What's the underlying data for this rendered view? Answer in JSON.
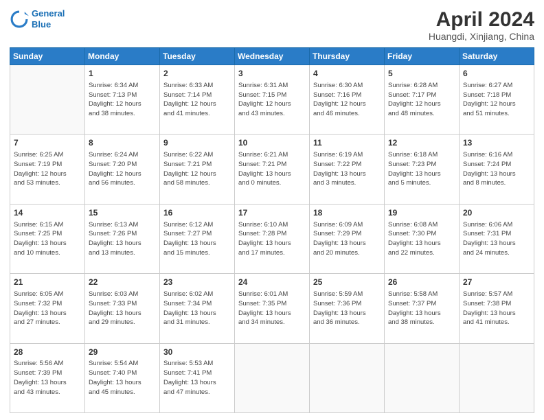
{
  "header": {
    "logo_line1": "General",
    "logo_line2": "Blue",
    "title": "April 2024",
    "subtitle": "Huangdi, Xinjiang, China"
  },
  "columns": [
    "Sunday",
    "Monday",
    "Tuesday",
    "Wednesday",
    "Thursday",
    "Friday",
    "Saturday"
  ],
  "weeks": [
    [
      {
        "num": "",
        "info": ""
      },
      {
        "num": "1",
        "info": "Sunrise: 6:34 AM\nSunset: 7:13 PM\nDaylight: 12 hours\nand 38 minutes."
      },
      {
        "num": "2",
        "info": "Sunrise: 6:33 AM\nSunset: 7:14 PM\nDaylight: 12 hours\nand 41 minutes."
      },
      {
        "num": "3",
        "info": "Sunrise: 6:31 AM\nSunset: 7:15 PM\nDaylight: 12 hours\nand 43 minutes."
      },
      {
        "num": "4",
        "info": "Sunrise: 6:30 AM\nSunset: 7:16 PM\nDaylight: 12 hours\nand 46 minutes."
      },
      {
        "num": "5",
        "info": "Sunrise: 6:28 AM\nSunset: 7:17 PM\nDaylight: 12 hours\nand 48 minutes."
      },
      {
        "num": "6",
        "info": "Sunrise: 6:27 AM\nSunset: 7:18 PM\nDaylight: 12 hours\nand 51 minutes."
      }
    ],
    [
      {
        "num": "7",
        "info": "Sunrise: 6:25 AM\nSunset: 7:19 PM\nDaylight: 12 hours\nand 53 minutes."
      },
      {
        "num": "8",
        "info": "Sunrise: 6:24 AM\nSunset: 7:20 PM\nDaylight: 12 hours\nand 56 minutes."
      },
      {
        "num": "9",
        "info": "Sunrise: 6:22 AM\nSunset: 7:21 PM\nDaylight: 12 hours\nand 58 minutes."
      },
      {
        "num": "10",
        "info": "Sunrise: 6:21 AM\nSunset: 7:21 PM\nDaylight: 13 hours\nand 0 minutes."
      },
      {
        "num": "11",
        "info": "Sunrise: 6:19 AM\nSunset: 7:22 PM\nDaylight: 13 hours\nand 3 minutes."
      },
      {
        "num": "12",
        "info": "Sunrise: 6:18 AM\nSunset: 7:23 PM\nDaylight: 13 hours\nand 5 minutes."
      },
      {
        "num": "13",
        "info": "Sunrise: 6:16 AM\nSunset: 7:24 PM\nDaylight: 13 hours\nand 8 minutes."
      }
    ],
    [
      {
        "num": "14",
        "info": "Sunrise: 6:15 AM\nSunset: 7:25 PM\nDaylight: 13 hours\nand 10 minutes."
      },
      {
        "num": "15",
        "info": "Sunrise: 6:13 AM\nSunset: 7:26 PM\nDaylight: 13 hours\nand 13 minutes."
      },
      {
        "num": "16",
        "info": "Sunrise: 6:12 AM\nSunset: 7:27 PM\nDaylight: 13 hours\nand 15 minutes."
      },
      {
        "num": "17",
        "info": "Sunrise: 6:10 AM\nSunset: 7:28 PM\nDaylight: 13 hours\nand 17 minutes."
      },
      {
        "num": "18",
        "info": "Sunrise: 6:09 AM\nSunset: 7:29 PM\nDaylight: 13 hours\nand 20 minutes."
      },
      {
        "num": "19",
        "info": "Sunrise: 6:08 AM\nSunset: 7:30 PM\nDaylight: 13 hours\nand 22 minutes."
      },
      {
        "num": "20",
        "info": "Sunrise: 6:06 AM\nSunset: 7:31 PM\nDaylight: 13 hours\nand 24 minutes."
      }
    ],
    [
      {
        "num": "21",
        "info": "Sunrise: 6:05 AM\nSunset: 7:32 PM\nDaylight: 13 hours\nand 27 minutes."
      },
      {
        "num": "22",
        "info": "Sunrise: 6:03 AM\nSunset: 7:33 PM\nDaylight: 13 hours\nand 29 minutes."
      },
      {
        "num": "23",
        "info": "Sunrise: 6:02 AM\nSunset: 7:34 PM\nDaylight: 13 hours\nand 31 minutes."
      },
      {
        "num": "24",
        "info": "Sunrise: 6:01 AM\nSunset: 7:35 PM\nDaylight: 13 hours\nand 34 minutes."
      },
      {
        "num": "25",
        "info": "Sunrise: 5:59 AM\nSunset: 7:36 PM\nDaylight: 13 hours\nand 36 minutes."
      },
      {
        "num": "26",
        "info": "Sunrise: 5:58 AM\nSunset: 7:37 PM\nDaylight: 13 hours\nand 38 minutes."
      },
      {
        "num": "27",
        "info": "Sunrise: 5:57 AM\nSunset: 7:38 PM\nDaylight: 13 hours\nand 41 minutes."
      }
    ],
    [
      {
        "num": "28",
        "info": "Sunrise: 5:56 AM\nSunset: 7:39 PM\nDaylight: 13 hours\nand 43 minutes."
      },
      {
        "num": "29",
        "info": "Sunrise: 5:54 AM\nSunset: 7:40 PM\nDaylight: 13 hours\nand 45 minutes."
      },
      {
        "num": "30",
        "info": "Sunrise: 5:53 AM\nSunset: 7:41 PM\nDaylight: 13 hours\nand 47 minutes."
      },
      {
        "num": "",
        "info": ""
      },
      {
        "num": "",
        "info": ""
      },
      {
        "num": "",
        "info": ""
      },
      {
        "num": "",
        "info": ""
      }
    ]
  ]
}
